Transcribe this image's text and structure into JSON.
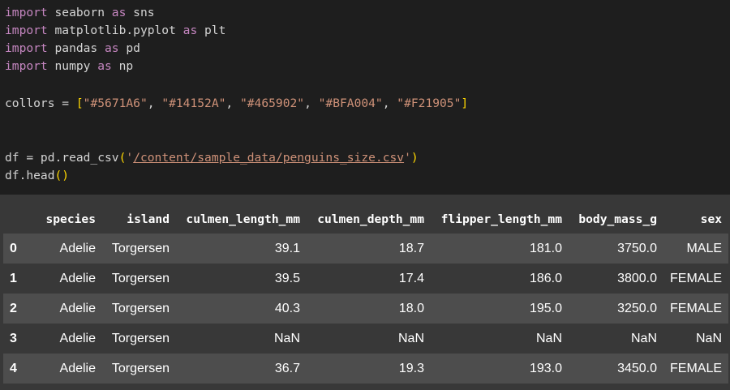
{
  "code": {
    "l1_kw": "import",
    "l1_rest": " seaborn ",
    "l1_kw2": "as",
    "l1_end": " sns",
    "l2_kw": "import",
    "l2_rest": " matplotlib.pyplot ",
    "l2_kw2": "as",
    "l2_end": " plt",
    "l3_kw": "import",
    "l3_rest": " pandas ",
    "l3_kw2": "as",
    "l3_end": " pd",
    "l4_kw": "import",
    "l4_rest": " numpy ",
    "l4_kw2": "as",
    "l4_end": " np",
    "l5_pre": "collors = ",
    "l5_open": "[",
    "l5_c1": "\"#5671A6\"",
    "l5_c2": "\"#14152A\"",
    "l5_c3": "\"#465902\"",
    "l5_c4": "\"#BFA004\"",
    "l5_c5": "\"#F21905\"",
    "comma": ", ",
    "l5_close": "]",
    "l6_pre": "df = pd.read_csv",
    "l6_open": "(",
    "l6_q1": "'",
    "l6_path": "/content/sample_data/penguins_size.csv",
    "l6_q2": "'",
    "l6_close": ")",
    "l7_pre": "df.head",
    "l7_parens": "()"
  },
  "table": {
    "headers": [
      "",
      "species",
      "island",
      "culmen_length_mm",
      "culmen_depth_mm",
      "flipper_length_mm",
      "body_mass_g",
      "sex"
    ],
    "rows": [
      [
        "0",
        "Adelie",
        "Torgersen",
        "39.1",
        "18.7",
        "181.0",
        "3750.0",
        "MALE"
      ],
      [
        "1",
        "Adelie",
        "Torgersen",
        "39.5",
        "17.4",
        "186.0",
        "3800.0",
        "FEMALE"
      ],
      [
        "2",
        "Adelie",
        "Torgersen",
        "40.3",
        "18.0",
        "195.0",
        "3250.0",
        "FEMALE"
      ],
      [
        "3",
        "Adelie",
        "Torgersen",
        "NaN",
        "NaN",
        "NaN",
        "NaN",
        "NaN"
      ],
      [
        "4",
        "Adelie",
        "Torgersen",
        "36.7",
        "19.3",
        "193.0",
        "3450.0",
        "FEMALE"
      ]
    ]
  }
}
